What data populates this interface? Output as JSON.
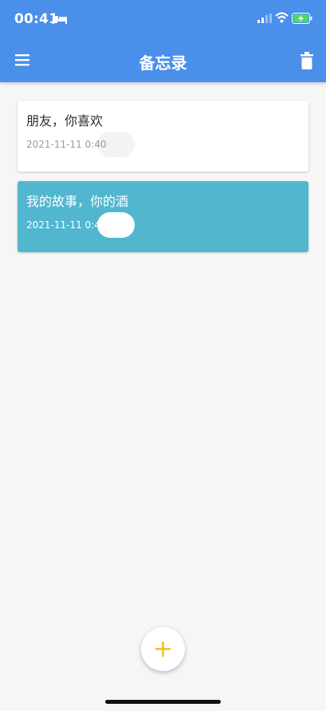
{
  "status_bar": {
    "time": "00:41",
    "icons": [
      "bed-icon",
      "signal-icon",
      "wifi-icon",
      "battery-charging-icon"
    ]
  },
  "app_bar": {
    "title": "备忘录",
    "left_icon": "menu-icon",
    "right_icon": "trash-icon",
    "color": "#4a8fe9"
  },
  "notes": [
    {
      "title": "朋友，你喜欢",
      "date": "2021-11-11 0:40",
      "selected": false,
      "background": "#ffffff"
    },
    {
      "title": "我的故事，你的酒",
      "date": "2021-11-11 0:40",
      "selected": true,
      "background": "#52b6cf"
    }
  ],
  "fab": {
    "label": "+",
    "icon": "plus-icon",
    "color": "#f2c01e"
  }
}
